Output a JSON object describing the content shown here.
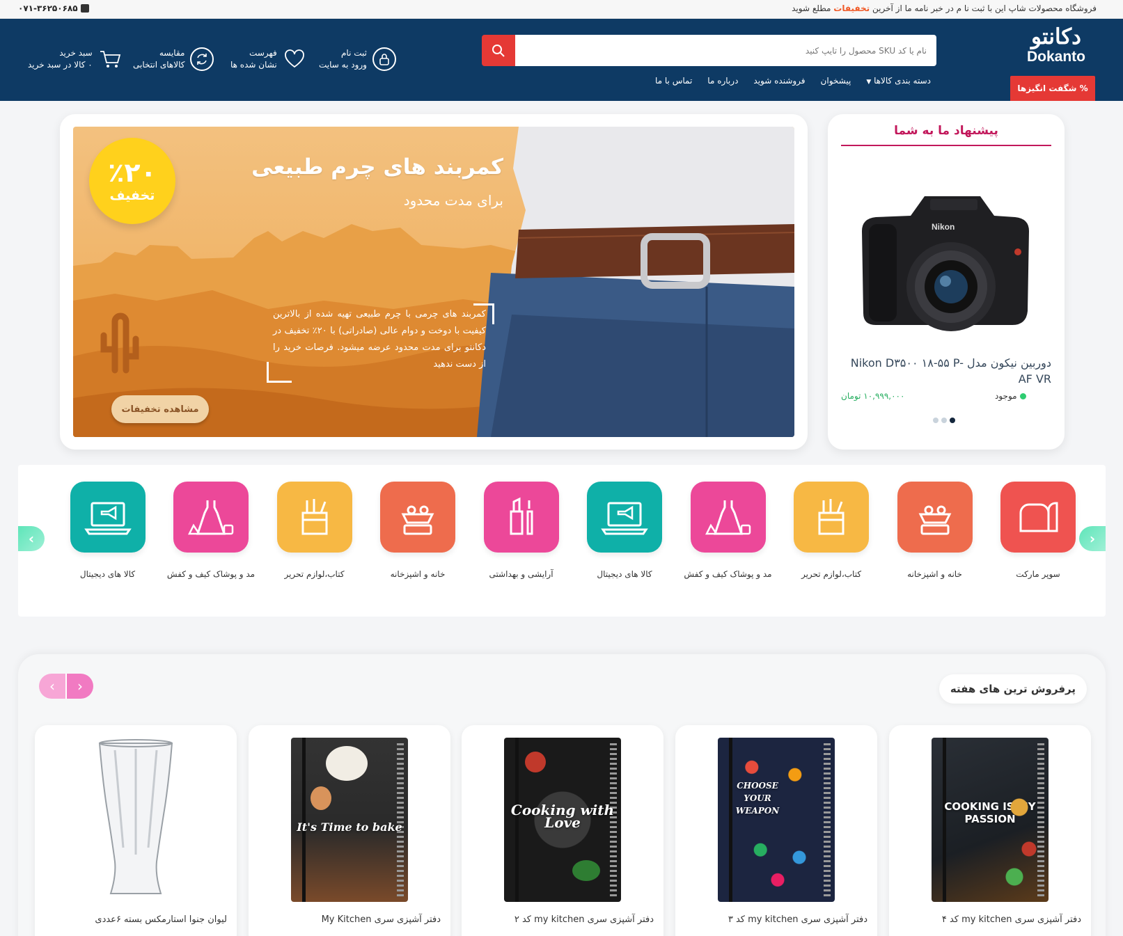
{
  "topbar": {
    "promo_before": "فروشگاه محصولات شاپ این با ثبت نا م در خبر نامه ما از آخرین",
    "promo_highlight": "تخفیفات",
    "promo_after": "مطلع شوید",
    "phone": "۰۷۱-۳۶۲۵۰۶۸۵"
  },
  "header": {
    "logo_fa": "دکانتو",
    "logo_en": "Dokanto",
    "offers_button": "% شگفت انگیزها",
    "search_placeholder": "نام یا کد SKU محصول را تایپ کنید",
    "nav": [
      "دسته بندی کالاها",
      "پیشخوان",
      "فروشنده شوید",
      "درباره ما",
      "تماس با ما"
    ],
    "login": {
      "line1": "ثبت نام",
      "line2": "ورود به سایت"
    },
    "wishlist": {
      "line1": "فهرست",
      "line2": "نشان شده ها"
    },
    "compare": {
      "line1": "مقایسه",
      "line2": "کالاهای انتخابی"
    },
    "cart": {
      "line1": "سبد خرید",
      "line2": "۰ کالا در سبد خرید"
    }
  },
  "hero": {
    "badge_percent": "٪۲۰",
    "badge_label": "تخفیف",
    "title": "کمربند های چرم طبیعی",
    "subtitle": "برای مدت محدود",
    "description": "کمربند های چرمی با چرم طبیعی تهیه شده از بالاترین کیفیت با دوخت و دوام عالی (صادراتی) با ۲۰٪ تخفیف در دکانتو برای مدت محدود عرضه میشود. فرصات خرید را از دست ندهید",
    "button": "مشاهده تخفیفات"
  },
  "offer": {
    "title": "پیشنهاد ما به شما",
    "product_name": "دوربین نیکون مدل Nikon D۳۵۰۰ ۱۸-۵۵ P-AF VR",
    "stock": "موجود",
    "price": "۱۰,۹۹۹,۰۰۰ تومان",
    "slide_count": 3,
    "active_slide": 3
  },
  "categories": [
    {
      "label": "سوپر مارکت",
      "color": "#ef5350",
      "icon": "bread-icon"
    },
    {
      "label": "خانه و اشپزخانه",
      "color": "#ee6c4d",
      "icon": "kitchen-scale-icon"
    },
    {
      "label": "کتاب،لوازم تحریر",
      "color": "#f7b844",
      "icon": "stationery-icon"
    },
    {
      "label": "مد و پوشاک کیف و کفش",
      "color": "#ec4899",
      "icon": "dress-icon"
    },
    {
      "label": "کالا های دیجیتال",
      "color": "#0fb0a8",
      "icon": "laptop-icon"
    },
    {
      "label": "آرایشی و بهداشتی",
      "color": "#ec4899",
      "icon": "lipstick-icon"
    },
    {
      "label": "خانه و اشپزخانه",
      "color": "#ee6c4d",
      "icon": "kitchen-scale-icon"
    },
    {
      "label": "کتاب،لوازم تحریر",
      "color": "#f7b844",
      "icon": "stationery-icon"
    },
    {
      "label": "مد و پوشاک کیف و کفش",
      "color": "#ec4899",
      "icon": "dress-icon"
    },
    {
      "label": "کالا های دیجیتال",
      "color": "#0fb0a8",
      "icon": "laptop-icon"
    }
  ],
  "best_sellers": {
    "title": "پرفروش ترین های هفته",
    "products": [
      {
        "name": "دفتر آشپزی سری my kitchen کد ۴",
        "cover": "COOKING IS MY PASSION"
      },
      {
        "name": "دفتر آشپزی سری my kitchen کد ۳",
        "cover": "CHOOSE YOUR WEAPON"
      },
      {
        "name": "دفتر آشپزی سری my kitchen کد ۲",
        "cover": "Cooking with Love"
      },
      {
        "name": "دفتر آشپزی سری My Kitchen",
        "cover": "It's Time to bake"
      },
      {
        "name": "لیوان جنوا استارمکس بسته ۶عددی",
        "cover": ""
      }
    ]
  },
  "colors": {
    "header": "#0e3a64",
    "accent": "#e53935",
    "offer_title": "#c2185b",
    "price": "#27ae60"
  }
}
